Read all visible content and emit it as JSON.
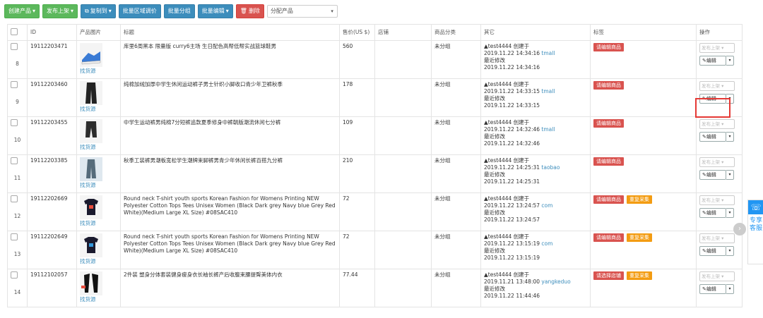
{
  "toolbar": {
    "create": "创建产品",
    "publish": "发布上架",
    "copy": "复制到",
    "region_price": "批量区域调价",
    "batch_group": "批量分组",
    "batch_edit": "批量编辑",
    "delete": "删除",
    "group_select": "分配产品"
  },
  "columns": [
    "ID",
    "产品图片",
    "标题",
    "售价(US $)",
    "店铺",
    "商品分类",
    "其它",
    "标签",
    "操作"
  ],
  "rows": [
    {
      "num": "8",
      "id": "19112203471",
      "find": "找货源",
      "title": "库里6周黑本 限量版 curry6主场 生日配色高帮低帮实战篮球鞋男",
      "price": "560",
      "shop": "",
      "category": "未分组",
      "creator": "test4444 创建于",
      "created": "2019.11.22 14:34:16",
      "platform": "tmall",
      "modified_label": "最近修改",
      "modified": "2019.11.22 14:34:16",
      "tags": [
        {
          "text": "请编辑商品",
          "color": "red"
        }
      ],
      "publish": "发布上架",
      "edit": "编辑"
    },
    {
      "num": "9",
      "id": "19112203460",
      "find": "找货源",
      "title": "纯棉加绒加厚中学生休闲运动裤子男士针织小脚收口青少年卫裤秋季",
      "price": "178",
      "shop": "",
      "category": "未分组",
      "creator": "test4444 创建于",
      "created": "2019.11.22 14:33:15",
      "platform": "tmall",
      "modified_label": "最近修改",
      "modified": "2019.11.22 14:33:15",
      "tags": [
        {
          "text": "请编辑商品",
          "color": "red"
        }
      ],
      "publish": "发布上架",
      "edit": "编辑"
    },
    {
      "num": "10",
      "id": "19112203455",
      "find": "找货源",
      "title": "中学生运动裤男纯棉7分短裤追款夏季修身中裤朝版潮流休闲七分裤",
      "price": "109",
      "shop": "",
      "category": "未分组",
      "creator": "test4444 创建于",
      "created": "2019.11.22 14:32:46",
      "platform": "tmall",
      "modified_label": "最近修改",
      "modified": "2019.11.22 14:32:46",
      "tags": [
        {
          "text": "请编辑商品",
          "color": "red"
        }
      ],
      "publish": "发布上架",
      "edit": "编辑"
    },
    {
      "num": "11",
      "id": "19112203385",
      "find": "找货源",
      "title": "秋季工装裤男潮板宽松学生潮牌束脚裤男青少年休闲长裤百搭九分裤",
      "price": "210",
      "shop": "",
      "category": "未分组",
      "creator": "test4444 创建于",
      "created": "2019.11.22 14:25:31",
      "platform": "taobao",
      "modified_label": "最近修改",
      "modified": "2019.11.22 14:25:31",
      "tags": [
        {
          "text": "请编辑商品",
          "color": "red"
        }
      ],
      "publish": "发布上架",
      "edit": "编辑"
    },
    {
      "num": "12",
      "id": "19112202669",
      "find": "找货源",
      "title": "Round neck T-shirt youth sports Korean Fashion for Womens Printing NEW Polyester Cotton Tops Tees Unisex Women (Black Dark grey Navy blue Grey Red White)(Medium Large XL Size) #08SAC410",
      "price": "72",
      "shop": "",
      "category": "未分组",
      "creator": "test4444 创建于",
      "created": "2019.11.22 13:24:57",
      "platform": "com",
      "modified_label": "最近修改",
      "modified": "2019.11.22 13:24:57",
      "tags": [
        {
          "text": "请编辑商品",
          "color": "red"
        },
        {
          "text": "重复采集",
          "color": "orange"
        }
      ],
      "publish": "发布上架",
      "edit": "编辑"
    },
    {
      "num": "13",
      "id": "19112202649",
      "find": "找货源",
      "title": "Round neck T-shirt youth sports Korean Fashion for Womens Printing NEW Polyester Cotton Tops Tees Unisex Women (Black Dark grey Navy blue Grey Red White)(Medium Large XL Size) #08SAC410",
      "price": "72",
      "shop": "",
      "category": "未分组",
      "creator": "test4444 创建于",
      "created": "2019.11.22 13:15:19",
      "platform": "com",
      "modified_label": "最近修改",
      "modified": "2019.11.22 13:15:19",
      "tags": [
        {
          "text": "请编辑商品",
          "color": "red"
        },
        {
          "text": "重复采集",
          "color": "orange"
        }
      ],
      "publish": "发布上架",
      "edit": "编辑"
    },
    {
      "num": "14",
      "id": "19112102057",
      "find": "找货源",
      "title": "2件装 塑身分体套装健身瘦身衣长袖长裤产后收腹束腰提臀美体内衣",
      "price": "77.44",
      "shop": "",
      "category": "未分组",
      "creator": "test4444 创建于",
      "created": "2019.11.21 13:48:00",
      "platform": "yangkeduo",
      "modified_label": "最近修改",
      "modified": "2019.11.22 11:44:46",
      "tags": [
        {
          "text": "请选择店铺",
          "color": "red"
        },
        {
          "text": "重复采集",
          "color": "orange"
        }
      ],
      "publish": "发布上架",
      "edit": "编辑"
    }
  ],
  "widget": {
    "text": "专享客服"
  }
}
